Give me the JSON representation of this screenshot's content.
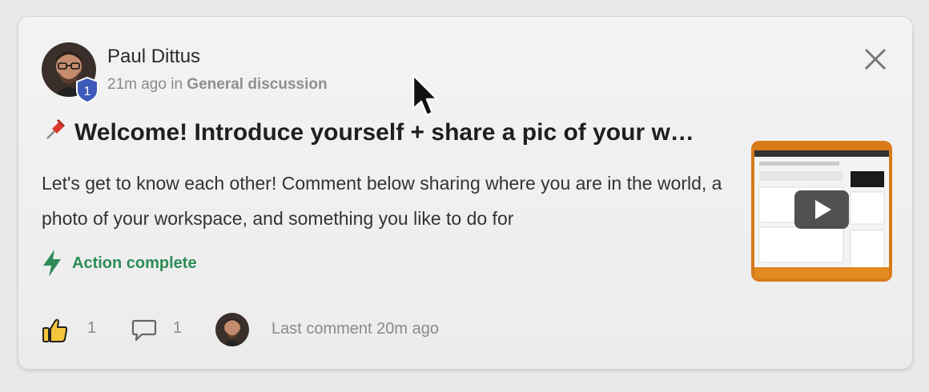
{
  "post": {
    "author": "Paul Dittus",
    "time_ago": "21m ago in ",
    "space": "General discussion",
    "level": "1",
    "title": "Welcome! Introduce yourself + share a pic of your w…",
    "body": "Let's get to know each other! Comment below sharing where you are in the world, a photo of your workspace, and something you like to do for",
    "action_label": "Action complete"
  },
  "footer": {
    "likes": "1",
    "comments": "1",
    "last_comment": "Last comment 20m ago"
  },
  "icons": [
    "pin-icon",
    "close-icon",
    "lightning-icon",
    "thumbs-up-icon",
    "comment-icon",
    "play-icon"
  ],
  "colors": {
    "accent_green": "#2e8b57",
    "badge_blue": "#3d5bb8"
  }
}
